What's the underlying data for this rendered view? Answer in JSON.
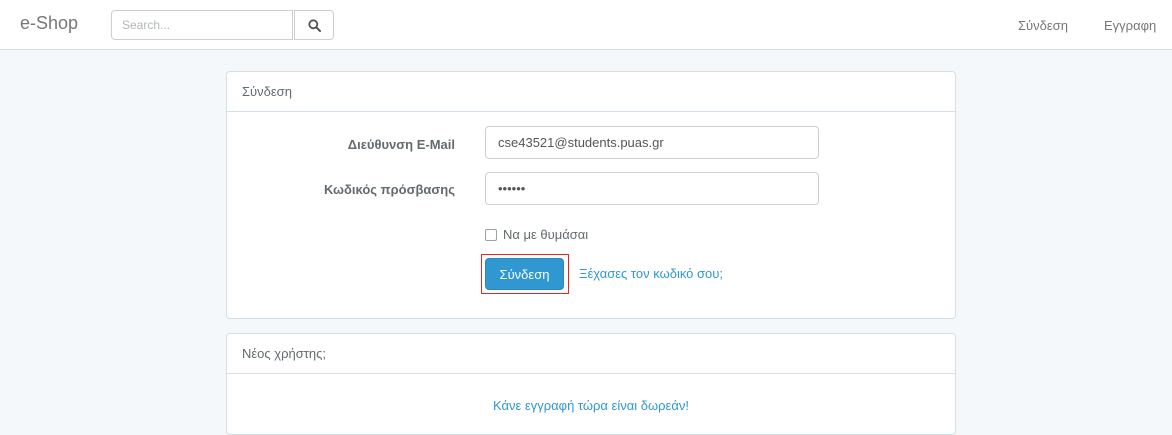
{
  "navbar": {
    "brand": "e-Shop",
    "search": {
      "placeholder": "Search...",
      "value": ""
    },
    "links": {
      "login": "Σύνδεση",
      "register": "Εγγραφη"
    }
  },
  "login_panel": {
    "heading": "Σύνδεση",
    "email_label": "Διεύθυνση E-Mail",
    "email_value": "cse43521@students.puas.gr",
    "password_label": "Κωδικός πρόσβασης",
    "password_value": "••••••",
    "remember_label": "Να με θυμάσαι",
    "remember_checked": false,
    "submit_label": "Σύνδεση",
    "forgot_link": "Ξέχασες τον κωδικό σου;"
  },
  "new_user_panel": {
    "heading": "Νέος χρήστης;",
    "register_link": "Κάνε εγγραφή τώρα είναι δωρεάν!"
  },
  "colors": {
    "accent": "#3097d1",
    "highlight": "#e0272a",
    "background": "#f5f8fa"
  },
  "icons": {
    "search": "search-icon"
  }
}
